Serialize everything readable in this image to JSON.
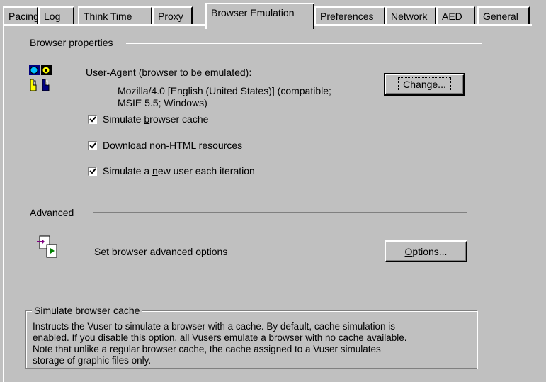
{
  "tabs": [
    {
      "label": "Pacing"
    },
    {
      "label": "Log"
    },
    {
      "label": "Think Time"
    },
    {
      "label": "Proxy"
    },
    {
      "label": "Browser Emulation"
    },
    {
      "label": "Preferences"
    },
    {
      "label": "Network"
    },
    {
      "label": "AED"
    },
    {
      "label": "General"
    }
  ],
  "active_tab": "Browser Emulation",
  "browser_properties": {
    "group_label": "Browser properties",
    "icon": "browser-user-icon",
    "user_agent_label": "User-Agent (browser to be emulated):",
    "user_agent_line1": "Mozilla/4.0 [English (United States)] (compatible;",
    "user_agent_line2": "MSIE 5.5; Windows)",
    "change_button": {
      "pre": "",
      "key": "C",
      "post": "hange..."
    },
    "checkboxes": [
      {
        "pre": "Simulate ",
        "key": "b",
        "post": "rowser cache",
        "checked": true
      },
      {
        "pre": "",
        "key": "D",
        "post": "ownload non-HTML resources",
        "checked": true
      },
      {
        "pre": "Simulate a ",
        "key": "n",
        "post": "ew user each iteration",
        "checked": true
      }
    ]
  },
  "advanced": {
    "group_label": "Advanced",
    "icon": "advanced-options-icon",
    "description": "Set browser advanced options",
    "options_button": {
      "pre": "",
      "key": "O",
      "post": "ptions..."
    }
  },
  "help_box": {
    "title": "Simulate browser cache",
    "lines": [
      "Instructs the Vuser to simulate a browser with a cache. By default, cache simulation is",
      "enabled. If you disable this option, all Vusers emulate a browser with no cache available.",
      "Note that unlike a regular browser cache, the cache assigned to a Vuser simulates",
      "storage of graphic files only."
    ]
  }
}
